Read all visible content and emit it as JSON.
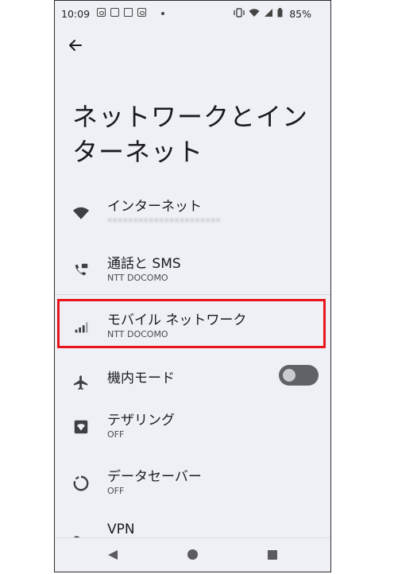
{
  "status_bar": {
    "time": "10:09",
    "battery_percent": "85%",
    "icons": [
      "d-icon",
      "media-icon",
      "gift-icon",
      "d-icon",
      "dot",
      "vibrate-icon",
      "wifi-icon",
      "signal-icon",
      "battery-icon"
    ]
  },
  "page": {
    "title_line1": "ネットワークとイン",
    "title_line2": "ターネット"
  },
  "items": [
    {
      "label": "インターネット",
      "sub": "••••••••••••••••••••••",
      "icon": "wifi-icon"
    },
    {
      "label": "通話と SMS",
      "sub": "NTT DOCOMO",
      "icon": "call-sms-icon"
    },
    {
      "label": "モバイル ネットワーク",
      "sub": "NTT DOCOMO",
      "icon": "signal-bars-icon"
    },
    {
      "label": "機内モード",
      "sub": "",
      "icon": "airplane-icon"
    },
    {
      "label": "テザリング",
      "sub": "OFF",
      "icon": "hotspot-icon"
    },
    {
      "label": "データセーバー",
      "sub": "OFF",
      "icon": "data-saver-icon"
    },
    {
      "label": "VPN",
      "sub": "",
      "icon": "vpn-key-icon"
    }
  ],
  "airplane_mode": {
    "enabled": false
  },
  "highlight": {
    "color": "#e8141c",
    "target": "モバイル ネットワーク"
  },
  "nav_bar": {
    "buttons": [
      "back-triangle-icon",
      "home-circle-icon",
      "recents-square-icon"
    ]
  }
}
